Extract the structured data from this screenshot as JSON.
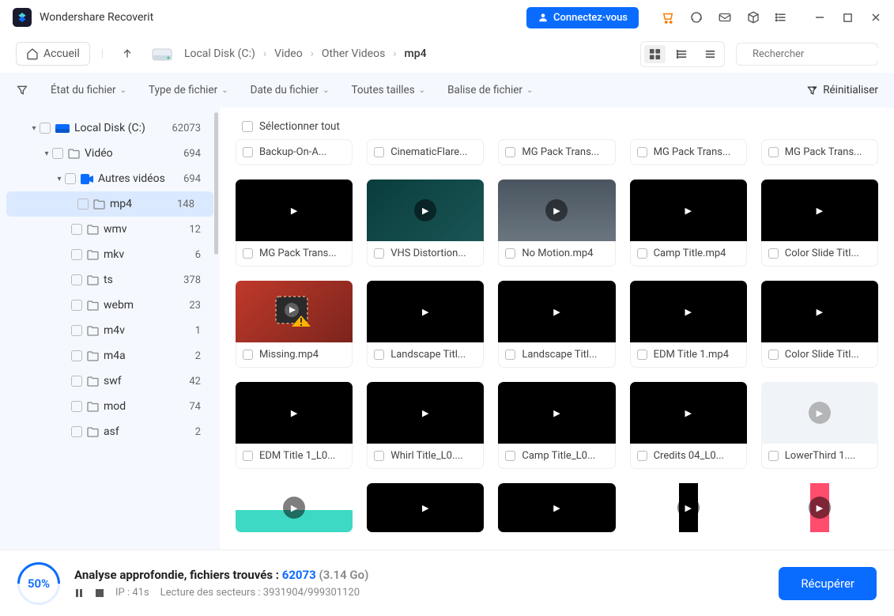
{
  "header": {
    "app_title": "Wondershare Recoverit",
    "connect_label": "Connectez-vous"
  },
  "navbar": {
    "home_label": "Accueil",
    "breadcrumb": [
      "Local Disk (C:)",
      "Video",
      "Other Videos",
      "mp4"
    ],
    "search_placeholder": "Rechercher"
  },
  "filters": {
    "items": [
      "État du fichier",
      "Type de fichier",
      "Date du fichier",
      "Toutes tailles",
      "Balise de fichier"
    ],
    "reset_label": "Réinitialiser"
  },
  "sidebar": {
    "items": [
      {
        "label": "Local Disk (C:)",
        "count": "62073",
        "level": 0,
        "icon": "disk",
        "expanded": true
      },
      {
        "label": "Vidéo",
        "count": "694",
        "level": 1,
        "icon": "folder",
        "expanded": true
      },
      {
        "label": "Autres vidéos",
        "count": "694",
        "level": 2,
        "icon": "video",
        "expanded": true
      },
      {
        "label": "mp4",
        "count": "148",
        "level": 3,
        "icon": "folder",
        "selected": true
      },
      {
        "label": "wmv",
        "count": "12",
        "level": 3,
        "icon": "folder"
      },
      {
        "label": "mkv",
        "count": "6",
        "level": 3,
        "icon": "folder"
      },
      {
        "label": "ts",
        "count": "378",
        "level": 3,
        "icon": "folder"
      },
      {
        "label": "webm",
        "count": "23",
        "level": 3,
        "icon": "folder"
      },
      {
        "label": "m4v",
        "count": "1",
        "level": 3,
        "icon": "folder"
      },
      {
        "label": "m4a",
        "count": "2",
        "level": 3,
        "icon": "folder"
      },
      {
        "label": "swf",
        "count": "42",
        "level": 3,
        "icon": "folder"
      },
      {
        "label": "mod",
        "count": "74",
        "level": 3,
        "icon": "folder"
      },
      {
        "label": "asf",
        "count": "2",
        "level": 3,
        "icon": "folder"
      }
    ]
  },
  "content": {
    "select_all_label": "Sélectionner tout",
    "items": [
      {
        "label": "Backup-On-A...",
        "thumb": "none"
      },
      {
        "label": "CinematicFlare...",
        "thumb": "none"
      },
      {
        "label": "MG Pack Trans...",
        "thumb": "none"
      },
      {
        "label": "MG Pack Trans...",
        "thumb": "none"
      },
      {
        "label": "MG Pack Trans...",
        "thumb": "none"
      },
      {
        "label": "MG Pack Trans...",
        "thumb": "black"
      },
      {
        "label": "VHS Distortion...",
        "thumb": "teal"
      },
      {
        "label": "No Motion.mp4",
        "thumb": "gray"
      },
      {
        "label": "Camp Title.mp4",
        "thumb": "black"
      },
      {
        "label": "Color Slide Titl...",
        "thumb": "black"
      },
      {
        "label": "Missing.mp4",
        "thumb": "missing"
      },
      {
        "label": "Landscape Titl...",
        "thumb": "black"
      },
      {
        "label": "Landscape Titl...",
        "thumb": "black"
      },
      {
        "label": "EDM Title 1.mp4",
        "thumb": "black"
      },
      {
        "label": "Color Slide Titl...",
        "thumb": "black"
      },
      {
        "label": "EDM Title 1_L0...",
        "thumb": "black"
      },
      {
        "label": "Whirl Title_L0....",
        "thumb": "black"
      },
      {
        "label": "Camp Title_L0...",
        "thumb": "black"
      },
      {
        "label": "Credits 04_L0...",
        "thumb": "black"
      },
      {
        "label": "LowerThird 1....",
        "thumb": "light"
      },
      {
        "label": "",
        "thumb": "aqua-partial"
      },
      {
        "label": "",
        "thumb": "black-partial"
      },
      {
        "label": "",
        "thumb": "black-partial"
      },
      {
        "label": "",
        "thumb": "stripe-black-partial"
      },
      {
        "label": "",
        "thumb": "stripe-pink-partial"
      }
    ]
  },
  "footer": {
    "progress_pct": "50%",
    "line1_prefix": "Analyse approfondie, fichiers trouvés : ",
    "line1_count": "62073",
    "line1_size": " (3.14 Go)",
    "ip_label": "IP : 41s",
    "sectors_label": "Lecture des secteurs : 3931904/999301120",
    "recover_label": "Récupérer"
  }
}
